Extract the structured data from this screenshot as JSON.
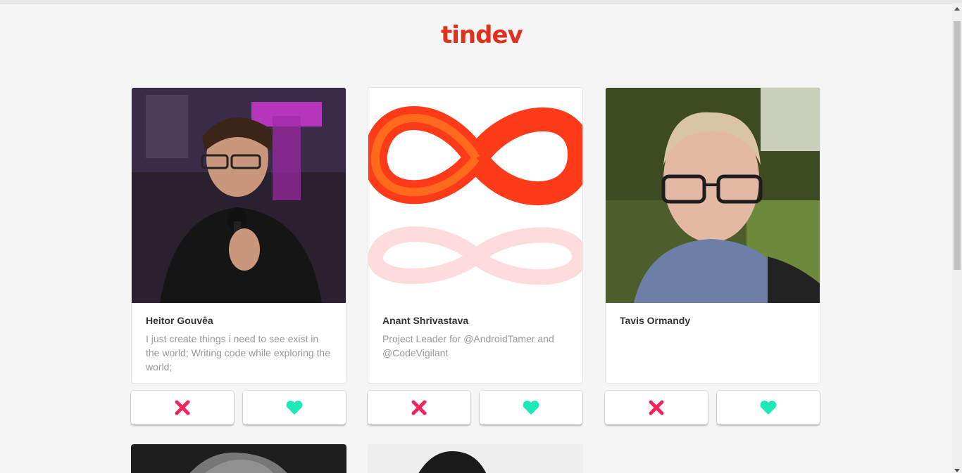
{
  "app": {
    "logo_text": "tindev",
    "brand_color": "#e0301e"
  },
  "actions": {
    "dislike_icon": "x-icon",
    "like_icon": "heart-icon",
    "dislike_color": "#f0265a",
    "like_color": "#1de9b6"
  },
  "devs": [
    {
      "name": "Heitor Gouvêa",
      "bio": "I just create things i need to see exist in the world; Writing code while exploring the world;"
    },
    {
      "name": "Anant Shrivastava",
      "bio": "Project Leader for @AndroidTamer and @CodeVigilant"
    },
    {
      "name": "Tavis Ormandy",
      "bio": ""
    }
  ]
}
